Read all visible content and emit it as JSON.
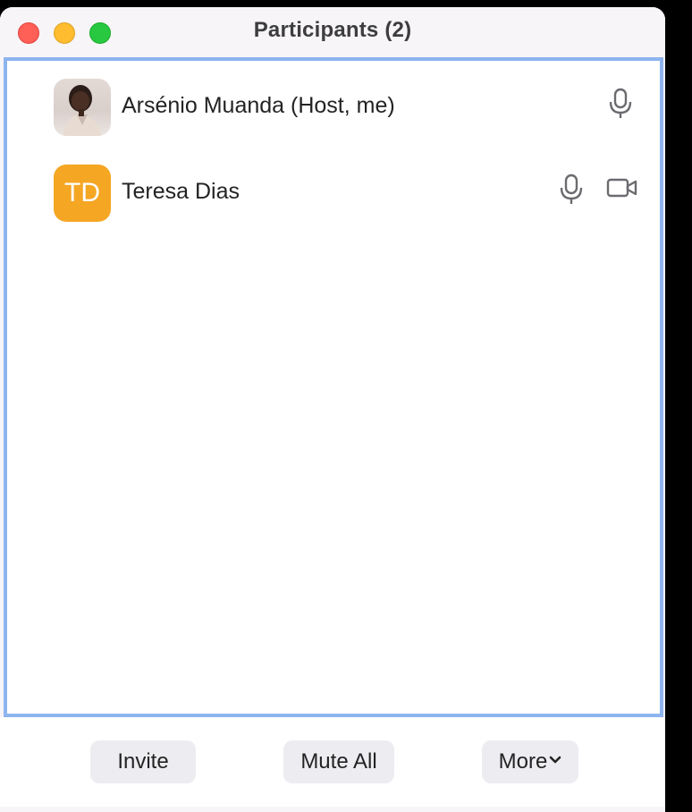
{
  "window": {
    "title": "Participants (2)"
  },
  "participants": [
    {
      "name": "Arsénio Muanda (Host, me)",
      "avatar_type": "photo",
      "icons": [
        "microphone-icon"
      ]
    },
    {
      "name": "Teresa Dias",
      "avatar_type": "initials",
      "initials": "TD",
      "avatar_color": "#f5a623",
      "icons": [
        "microphone-icon",
        "video-camera-icon"
      ]
    }
  ],
  "footer": {
    "invite_label": "Invite",
    "mute_all_label": "Mute All",
    "more_label": "More"
  },
  "colors": {
    "selection_border": "#8db4ef",
    "close": "#fe5f57",
    "minimize": "#febc2e",
    "maximize": "#28c840"
  }
}
